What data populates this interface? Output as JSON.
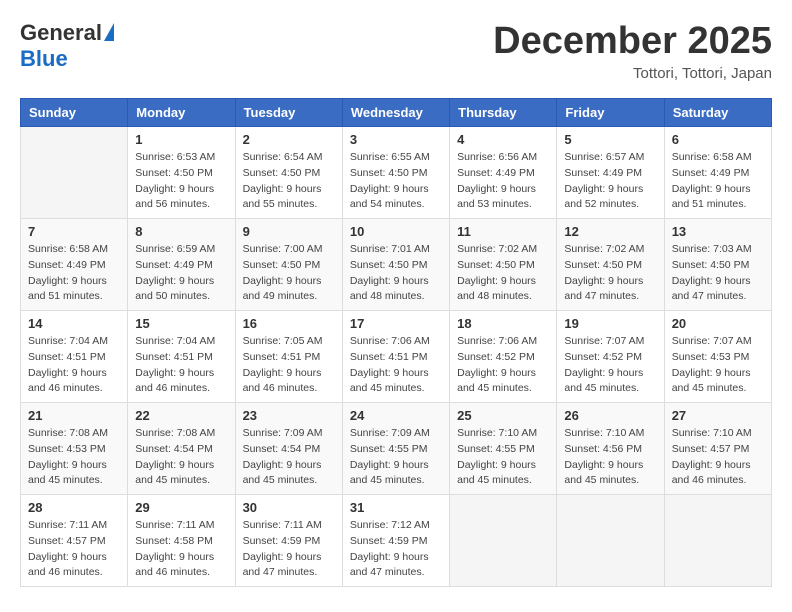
{
  "logo": {
    "general": "General",
    "blue": "Blue"
  },
  "title": "December 2025",
  "location": "Tottori, Tottori, Japan",
  "days_header": [
    "Sunday",
    "Monday",
    "Tuesday",
    "Wednesday",
    "Thursday",
    "Friday",
    "Saturday"
  ],
  "weeks": [
    [
      {
        "day": "",
        "info": ""
      },
      {
        "day": "1",
        "info": "Sunrise: 6:53 AM\nSunset: 4:50 PM\nDaylight: 9 hours\nand 56 minutes."
      },
      {
        "day": "2",
        "info": "Sunrise: 6:54 AM\nSunset: 4:50 PM\nDaylight: 9 hours\nand 55 minutes."
      },
      {
        "day": "3",
        "info": "Sunrise: 6:55 AM\nSunset: 4:50 PM\nDaylight: 9 hours\nand 54 minutes."
      },
      {
        "day": "4",
        "info": "Sunrise: 6:56 AM\nSunset: 4:49 PM\nDaylight: 9 hours\nand 53 minutes."
      },
      {
        "day": "5",
        "info": "Sunrise: 6:57 AM\nSunset: 4:49 PM\nDaylight: 9 hours\nand 52 minutes."
      },
      {
        "day": "6",
        "info": "Sunrise: 6:58 AM\nSunset: 4:49 PM\nDaylight: 9 hours\nand 51 minutes."
      }
    ],
    [
      {
        "day": "7",
        "info": "Sunrise: 6:58 AM\nSunset: 4:49 PM\nDaylight: 9 hours\nand 51 minutes."
      },
      {
        "day": "8",
        "info": "Sunrise: 6:59 AM\nSunset: 4:49 PM\nDaylight: 9 hours\nand 50 minutes."
      },
      {
        "day": "9",
        "info": "Sunrise: 7:00 AM\nSunset: 4:50 PM\nDaylight: 9 hours\nand 49 minutes."
      },
      {
        "day": "10",
        "info": "Sunrise: 7:01 AM\nSunset: 4:50 PM\nDaylight: 9 hours\nand 48 minutes."
      },
      {
        "day": "11",
        "info": "Sunrise: 7:02 AM\nSunset: 4:50 PM\nDaylight: 9 hours\nand 48 minutes."
      },
      {
        "day": "12",
        "info": "Sunrise: 7:02 AM\nSunset: 4:50 PM\nDaylight: 9 hours\nand 47 minutes."
      },
      {
        "day": "13",
        "info": "Sunrise: 7:03 AM\nSunset: 4:50 PM\nDaylight: 9 hours\nand 47 minutes."
      }
    ],
    [
      {
        "day": "14",
        "info": "Sunrise: 7:04 AM\nSunset: 4:51 PM\nDaylight: 9 hours\nand 46 minutes."
      },
      {
        "day": "15",
        "info": "Sunrise: 7:04 AM\nSunset: 4:51 PM\nDaylight: 9 hours\nand 46 minutes."
      },
      {
        "day": "16",
        "info": "Sunrise: 7:05 AM\nSunset: 4:51 PM\nDaylight: 9 hours\nand 46 minutes."
      },
      {
        "day": "17",
        "info": "Sunrise: 7:06 AM\nSunset: 4:51 PM\nDaylight: 9 hours\nand 45 minutes."
      },
      {
        "day": "18",
        "info": "Sunrise: 7:06 AM\nSunset: 4:52 PM\nDaylight: 9 hours\nand 45 minutes."
      },
      {
        "day": "19",
        "info": "Sunrise: 7:07 AM\nSunset: 4:52 PM\nDaylight: 9 hours\nand 45 minutes."
      },
      {
        "day": "20",
        "info": "Sunrise: 7:07 AM\nSunset: 4:53 PM\nDaylight: 9 hours\nand 45 minutes."
      }
    ],
    [
      {
        "day": "21",
        "info": "Sunrise: 7:08 AM\nSunset: 4:53 PM\nDaylight: 9 hours\nand 45 minutes."
      },
      {
        "day": "22",
        "info": "Sunrise: 7:08 AM\nSunset: 4:54 PM\nDaylight: 9 hours\nand 45 minutes."
      },
      {
        "day": "23",
        "info": "Sunrise: 7:09 AM\nSunset: 4:54 PM\nDaylight: 9 hours\nand 45 minutes."
      },
      {
        "day": "24",
        "info": "Sunrise: 7:09 AM\nSunset: 4:55 PM\nDaylight: 9 hours\nand 45 minutes."
      },
      {
        "day": "25",
        "info": "Sunrise: 7:10 AM\nSunset: 4:55 PM\nDaylight: 9 hours\nand 45 minutes."
      },
      {
        "day": "26",
        "info": "Sunrise: 7:10 AM\nSunset: 4:56 PM\nDaylight: 9 hours\nand 45 minutes."
      },
      {
        "day": "27",
        "info": "Sunrise: 7:10 AM\nSunset: 4:57 PM\nDaylight: 9 hours\nand 46 minutes."
      }
    ],
    [
      {
        "day": "28",
        "info": "Sunrise: 7:11 AM\nSunset: 4:57 PM\nDaylight: 9 hours\nand 46 minutes."
      },
      {
        "day": "29",
        "info": "Sunrise: 7:11 AM\nSunset: 4:58 PM\nDaylight: 9 hours\nand 46 minutes."
      },
      {
        "day": "30",
        "info": "Sunrise: 7:11 AM\nSunset: 4:59 PM\nDaylight: 9 hours\nand 47 minutes."
      },
      {
        "day": "31",
        "info": "Sunrise: 7:12 AM\nSunset: 4:59 PM\nDaylight: 9 hours\nand 47 minutes."
      },
      {
        "day": "",
        "info": ""
      },
      {
        "day": "",
        "info": ""
      },
      {
        "day": "",
        "info": ""
      }
    ]
  ]
}
